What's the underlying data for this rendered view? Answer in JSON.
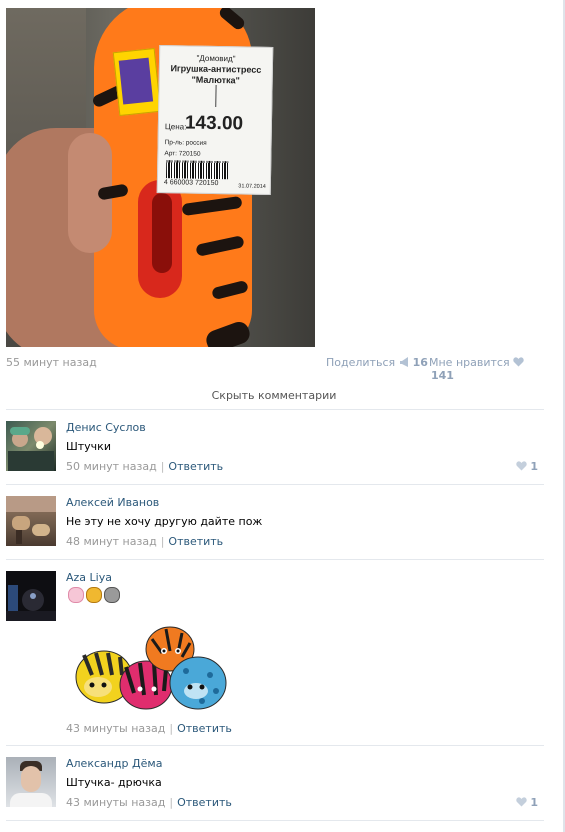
{
  "post": {
    "time": "55 минут назад",
    "share_label": "Поделиться",
    "share_count": "16",
    "like_label": "Мне нравится",
    "like_count": "141",
    "price_tag": {
      "brand": "\"Домовид\"",
      "name_line1": "Игрушка-антистресс",
      "name_line2": "\"Малютка\"",
      "price_label": "Цена:",
      "price": "143.00",
      "producer": "Пр-ль: россия",
      "article": "Арт: 720150",
      "barcode_number": "4 660003 720150",
      "date": "31.07.2014"
    }
  },
  "hide_comments_label": "Скрыть комментарии",
  "comments": [
    {
      "author": "Денис Суслов",
      "text": "Штучки",
      "time": "50 минут назад",
      "reply": "Ответить",
      "likes": "1"
    },
    {
      "author": "Алексей Иванов",
      "text": "Не эту не хочу другую дайте пож",
      "time": "48 минут назад",
      "reply": "Ответить",
      "likes": ""
    },
    {
      "author": "Aza Liya",
      "text": "",
      "time": "43 минуты назад",
      "reply": "Ответить",
      "likes": ""
    },
    {
      "author": "Александр Дёма",
      "text": "Штучка- дрючка",
      "time": "43 минуты назад",
      "reply": "Ответить",
      "likes": "1"
    }
  ],
  "icons": {
    "share": "megaphone-icon",
    "like": "heart-icon"
  },
  "colors": {
    "link": "#2b587a",
    "meta": "#999999",
    "counter": "#8fa1b8",
    "separator": "#e4e8ed"
  }
}
